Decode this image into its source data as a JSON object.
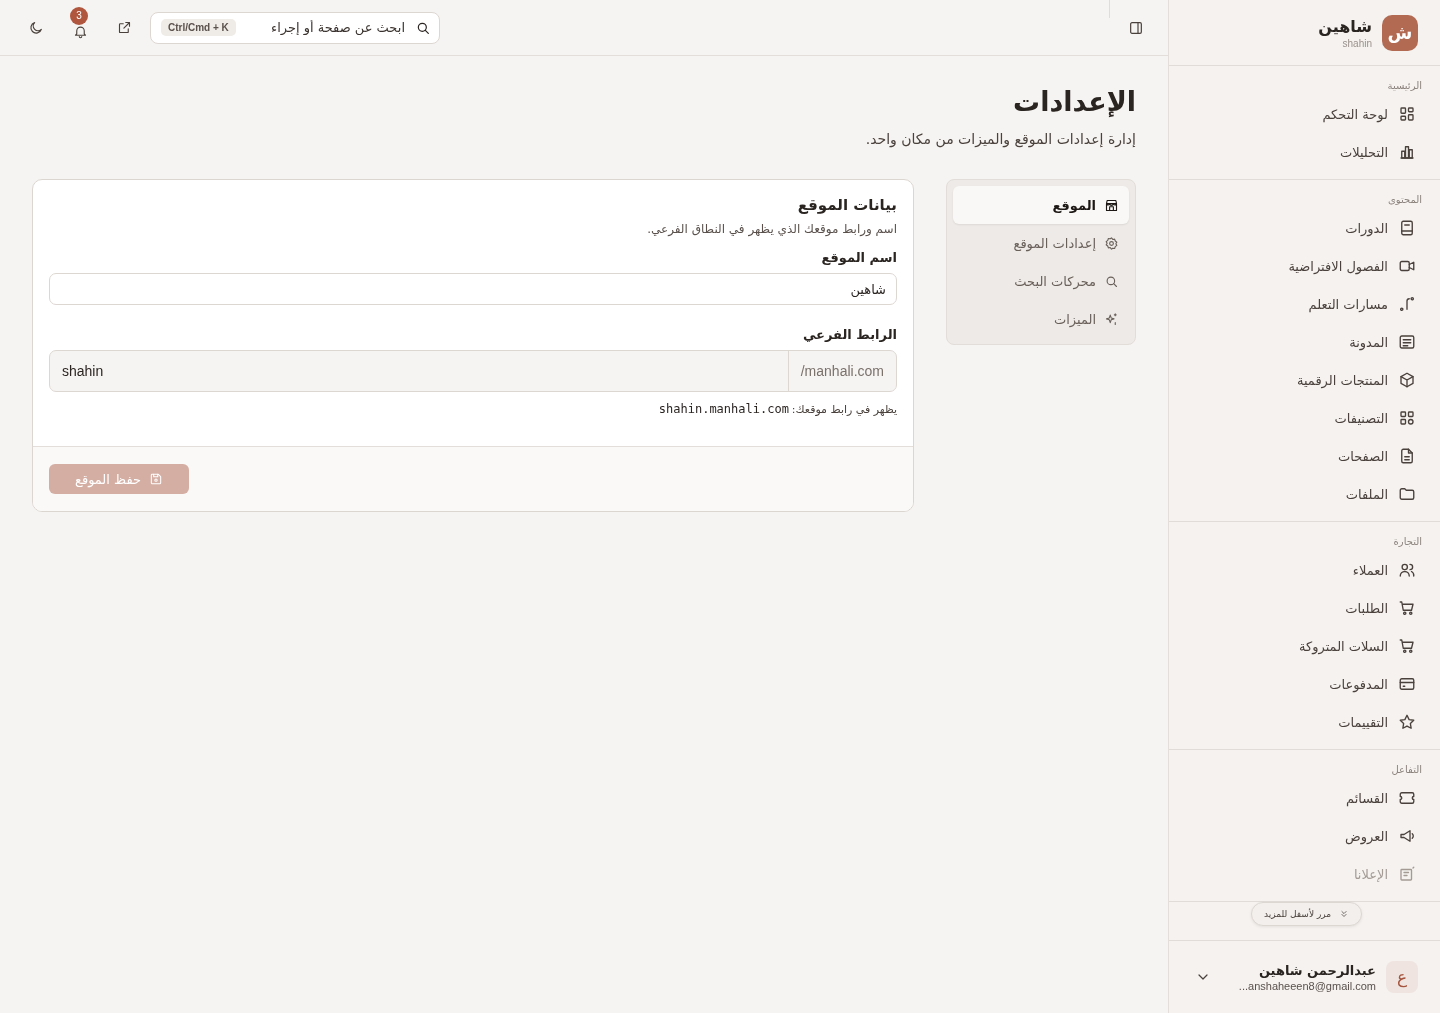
{
  "topbar": {
    "search": {
      "placeholder": "ابحث عن صفحة أو إجراء",
      "shortcut": "Ctrl/Cmd + K"
    },
    "notifications": {
      "count": "3"
    }
  },
  "sidebar": {
    "brand": {
      "logo_letter": "ش",
      "name": "شاهين",
      "slug": "shahin"
    },
    "sections": [
      {
        "title": "الرئيسية",
        "items": [
          {
            "label": "لوحة التحكم",
            "selected": false
          },
          {
            "label": "التحليلات",
            "selected": false
          }
        ]
      },
      {
        "title": "المحتوى",
        "items": [
          {
            "label": "الدورات",
            "selected": false
          },
          {
            "label": "الفصول الافتراضية",
            "selected": false
          },
          {
            "label": "مسارات التعلم",
            "selected": false
          },
          {
            "label": "المدونة",
            "selected": false
          },
          {
            "label": "المنتجات الرقمية",
            "selected": false
          },
          {
            "label": "التصنيفات",
            "selected": false
          },
          {
            "label": "الصفحات",
            "selected": false
          },
          {
            "label": "الملفات",
            "selected": false
          }
        ]
      },
      {
        "title": "التجارة",
        "items": [
          {
            "label": "العملاء",
            "selected": false
          },
          {
            "label": "الطلبات",
            "selected": false
          },
          {
            "label": "السلات المتروكة",
            "selected": false
          },
          {
            "label": "المدفوعات",
            "selected": false
          },
          {
            "label": "التقييمات",
            "selected": false
          }
        ]
      },
      {
        "title": "التفاعل",
        "items": [
          {
            "label": "القسائم",
            "selected": false
          },
          {
            "label": "العروض",
            "selected": false
          },
          {
            "label": "الإعلانا",
            "selected": false
          }
        ]
      }
    ],
    "scroll_hint": "مرر لأسفل للمزيد",
    "user": {
      "initial": "ع",
      "name": "عبدالرحمن شاهين",
      "email": "...anshaheeen8@gmail.com"
    }
  },
  "page": {
    "title": "الإعدادات",
    "subtitle": "إدارة إعدادات الموقع والميزات من مكان واحد."
  },
  "settings_nav": [
    {
      "label": "الموقع",
      "selected": true
    },
    {
      "label": "إعدادات الموقع",
      "selected": false
    },
    {
      "label": "محركات البحث",
      "selected": false
    },
    {
      "label": "الميزات",
      "selected": false
    }
  ],
  "card": {
    "title": "بيانات الموقع",
    "description": "اسم ورابط موقعك الذي يظهر في النطاق الفرعي.",
    "site_name": {
      "label": "اسم الموقع",
      "value": "شاهين"
    },
    "subdomain": {
      "label": "الرابط الفرعي",
      "value": "shahin",
      "suffix": "/manhali.com"
    },
    "hint": {
      "text": "يظهر في رابط موقعك:",
      "url": "shahin.manhali.com"
    },
    "save_button": {
      "label": "حفظ الموقع",
      "disabled": true
    }
  }
}
